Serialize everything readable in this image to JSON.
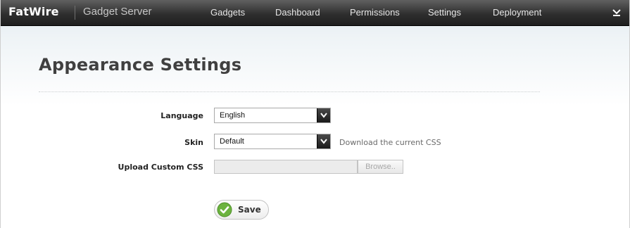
{
  "header": {
    "brand": "FatWire",
    "product": "Gadget Server",
    "nav": [
      {
        "label": "Gadgets"
      },
      {
        "label": "Dashboard"
      },
      {
        "label": "Permissions"
      },
      {
        "label": "Settings"
      },
      {
        "label": "Deployment"
      }
    ],
    "menu_icon": "chevron-down-icon"
  },
  "page": {
    "title": "Appearance Settings"
  },
  "form": {
    "language": {
      "label": "Language",
      "value": "English"
    },
    "skin": {
      "label": "Skin",
      "value": "Default",
      "download_link": "Download the current CSS"
    },
    "upload": {
      "label": "Upload Custom CSS",
      "value": "",
      "browse_label": "Browse.."
    },
    "save_label": "Save"
  },
  "colors": {
    "topbar": "#2f2f2f",
    "save_check": "#6cb33f"
  }
}
